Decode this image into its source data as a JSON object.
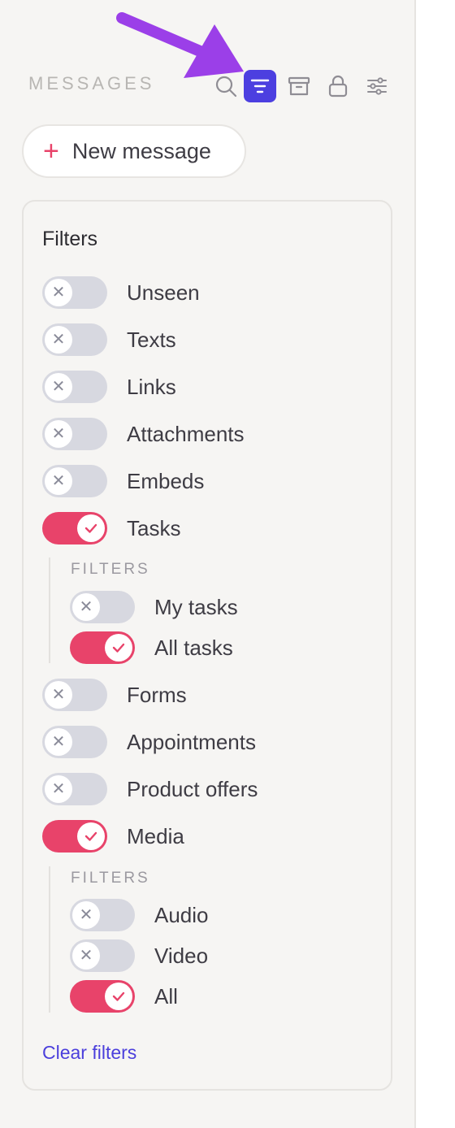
{
  "header": {
    "title": "MESSAGES",
    "icons": [
      "search-icon",
      "filter-icon",
      "archive-icon",
      "lock-icon",
      "settings-icon"
    ],
    "active_icon": "filter-icon"
  },
  "new_message": {
    "plus": "+",
    "label": "New message"
  },
  "filters": {
    "title": "Filters",
    "items": [
      {
        "label": "Unseen",
        "on": false
      },
      {
        "label": "Texts",
        "on": false
      },
      {
        "label": "Links",
        "on": false
      },
      {
        "label": "Attachments",
        "on": false
      },
      {
        "label": "Embeds",
        "on": false
      },
      {
        "label": "Tasks",
        "on": true
      },
      {
        "label": "Forms",
        "on": false
      },
      {
        "label": "Appointments",
        "on": false
      },
      {
        "label": "Product offers",
        "on": false
      },
      {
        "label": "Media",
        "on": true
      }
    ],
    "tasks_sub": {
      "title": "FILTERS",
      "items": [
        {
          "label": "My tasks",
          "on": false
        },
        {
          "label": "All tasks",
          "on": true
        }
      ]
    },
    "media_sub": {
      "title": "FILTERS",
      "items": [
        {
          "label": "Audio",
          "on": false
        },
        {
          "label": "Video",
          "on": false
        },
        {
          "label": "All",
          "on": true
        }
      ]
    },
    "clear_label": "Clear filters"
  },
  "colors": {
    "accent": "#e8436a",
    "brand": "#4c3fe0",
    "toggle_off": "#d7d8e0",
    "arrow": "#9b3fe8"
  }
}
